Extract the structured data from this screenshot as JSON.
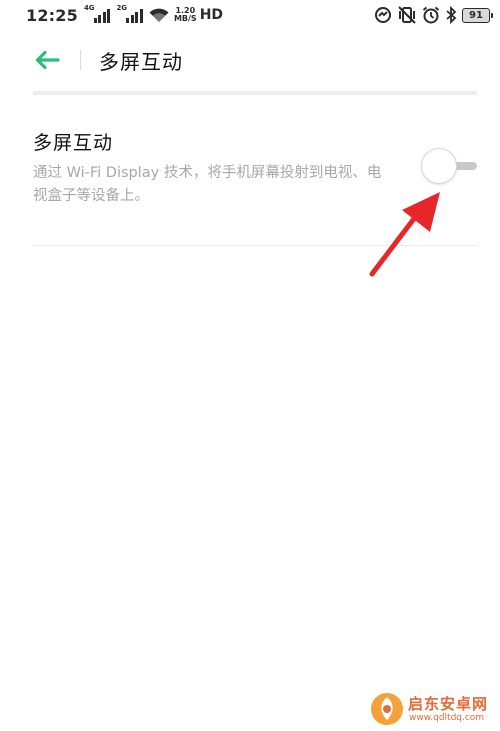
{
  "status_bar": {
    "time": "12:25",
    "signal1_tag": "4G",
    "signal2_tag": "2G",
    "net_speed_value": "1.20",
    "net_speed_unit": "MB/S",
    "hd_label": "HD",
    "battery_level": "91",
    "icons": [
      "wifi-icon",
      "data-saver-icon",
      "vibrate-icon",
      "alarm-icon",
      "bluetooth-icon"
    ]
  },
  "header": {
    "back_icon": "arrow-left-icon",
    "title": "多屏互动"
  },
  "setting": {
    "title": "多屏互动",
    "description": "通过 Wi-Fi Display 技术，将手机屏幕投射到电视、电视盒子等设备上。",
    "toggle_on": false
  },
  "watermark": {
    "name": "启东安卓网",
    "url": "www.qdltdq.com"
  },
  "colors": {
    "accent_green": "#2bbd79",
    "annotation_red": "#e8262a",
    "watermark_orange": "#e46a3a"
  }
}
